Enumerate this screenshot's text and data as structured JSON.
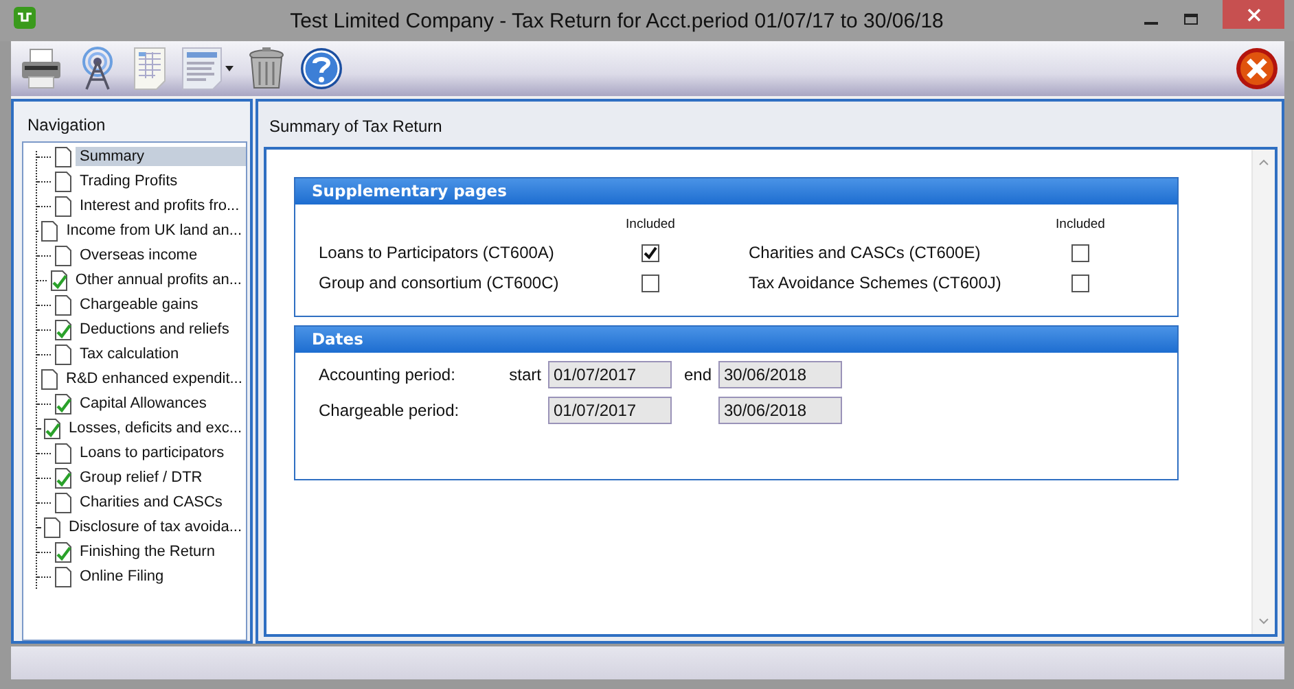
{
  "window": {
    "title": "Test Limited Company - Tax Return for Acct.period 01/07/17 to 30/06/18"
  },
  "navigation": {
    "title": "Navigation",
    "items": [
      {
        "label": "Summary",
        "done": false,
        "selected": true
      },
      {
        "label": "Trading Profits",
        "done": false,
        "selected": false
      },
      {
        "label": "Interest and profits fro...",
        "done": false,
        "selected": false
      },
      {
        "label": "Income from UK land an...",
        "done": false,
        "selected": false
      },
      {
        "label": "Overseas income",
        "done": false,
        "selected": false
      },
      {
        "label": "Other annual profits an...",
        "done": true,
        "selected": false
      },
      {
        "label": "Chargeable gains",
        "done": false,
        "selected": false
      },
      {
        "label": "Deductions and reliefs",
        "done": true,
        "selected": false
      },
      {
        "label": "Tax calculation",
        "done": false,
        "selected": false
      },
      {
        "label": "R&D enhanced expendit...",
        "done": false,
        "selected": false
      },
      {
        "label": "Capital Allowances",
        "done": true,
        "selected": false
      },
      {
        "label": "Losses, deficits and exc...",
        "done": true,
        "selected": false
      },
      {
        "label": "Loans to participators",
        "done": false,
        "selected": false
      },
      {
        "label": "Group relief / DTR",
        "done": true,
        "selected": false
      },
      {
        "label": "Charities and CASCs",
        "done": false,
        "selected": false
      },
      {
        "label": "Disclosure of tax avoida...",
        "done": false,
        "selected": false
      },
      {
        "label": "Finishing the Return",
        "done": true,
        "selected": false
      },
      {
        "label": "Online Filing",
        "done": false,
        "selected": false
      }
    ]
  },
  "content": {
    "title": "Summary of Tax Return",
    "supplementary": {
      "title": "Supplementary pages",
      "column_headers": [
        "Included",
        "Included"
      ],
      "pages": [
        {
          "label": "Loans to Participators (CT600A)",
          "checked": true
        },
        {
          "label": "Charities and CASCs (CT600E)",
          "checked": false
        },
        {
          "label": "Group and consortium (CT600C)",
          "checked": false
        },
        {
          "label": "Tax Avoidance Schemes (CT600J)",
          "checked": false
        }
      ]
    },
    "dates": {
      "title": "Dates",
      "rows": [
        {
          "label": "Accounting period:",
          "start_label": "start",
          "start": "01/07/2017",
          "end_label": "end",
          "end": "30/06/2018"
        },
        {
          "label": "Chargeable period:",
          "start": "01/07/2017",
          "end": "30/06/2018"
        }
      ]
    }
  }
}
